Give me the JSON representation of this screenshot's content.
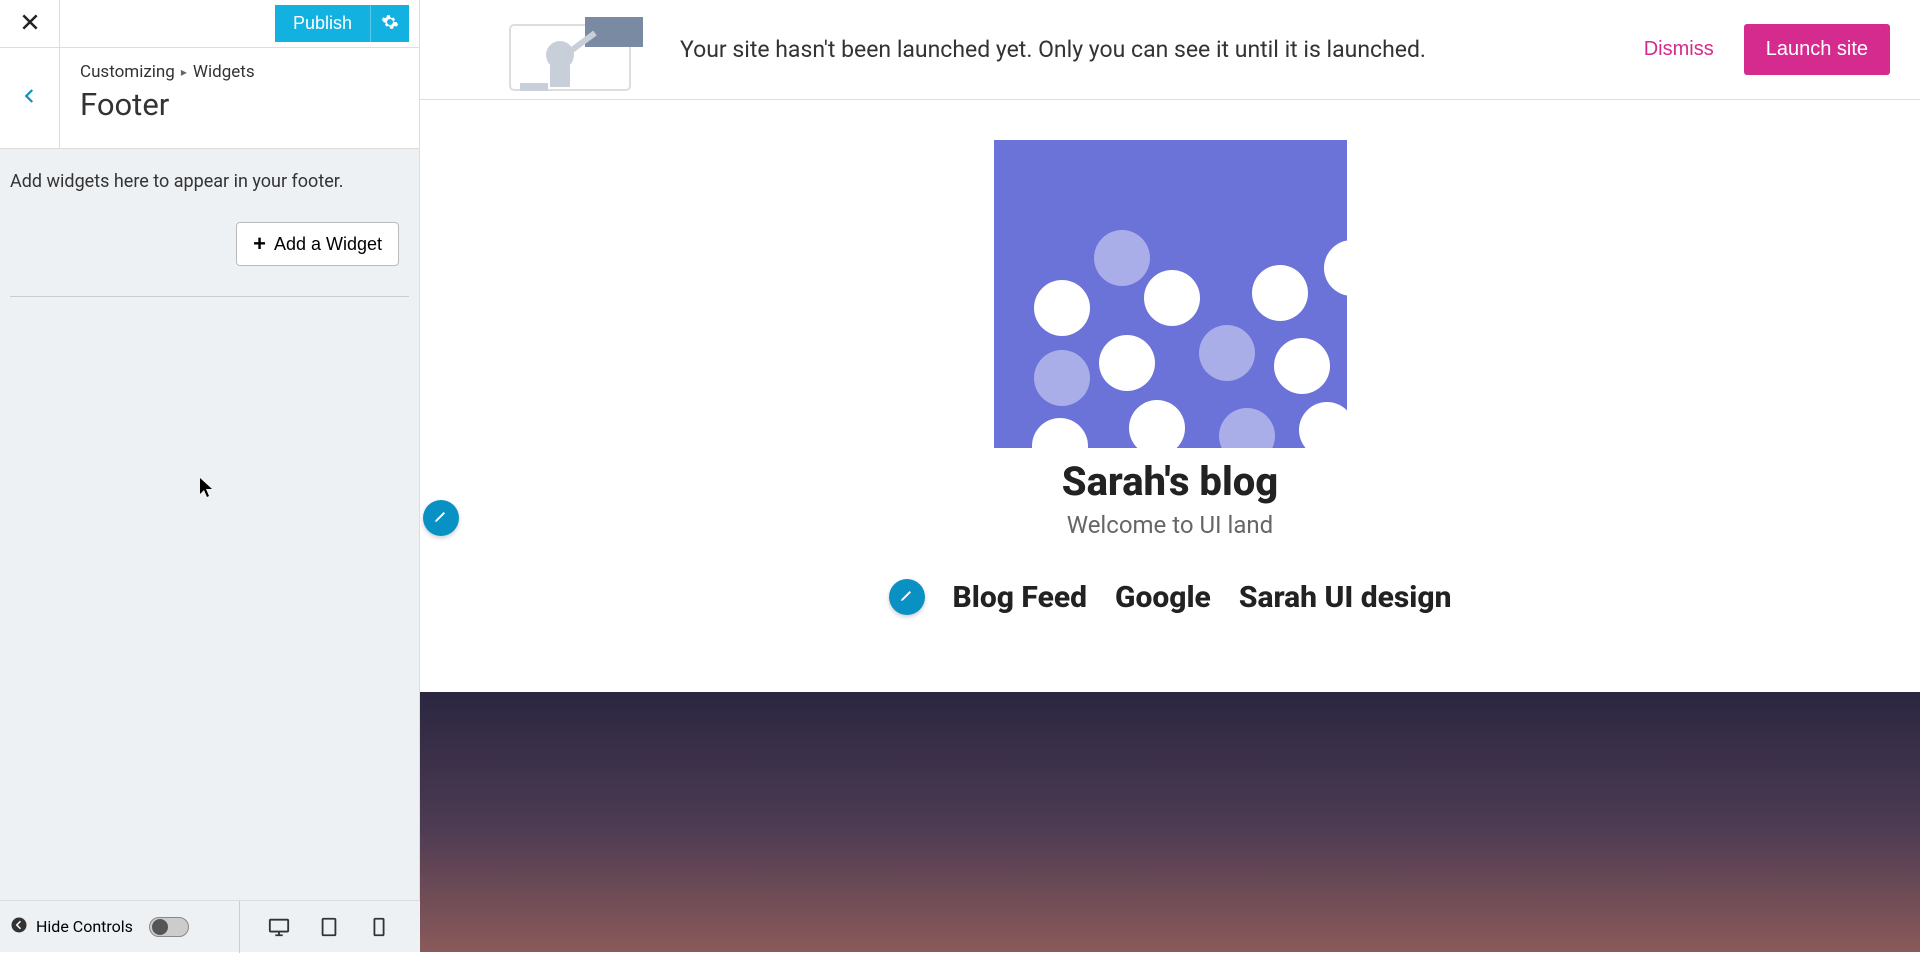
{
  "sidebar": {
    "publish_label": "Publish",
    "breadcrumb": {
      "root": "Customizing",
      "section": "Widgets"
    },
    "panel_title": "Footer",
    "description": "Add widgets here to appear in your footer.",
    "add_widget_label": "Add a Widget",
    "hide_controls_label": "Hide Controls"
  },
  "banner": {
    "message": "Your site hasn't been launched yet. Only you can see it until it is launched.",
    "dismiss_label": "Dismiss",
    "launch_label": "Launch site"
  },
  "site": {
    "title": "Sarah's blog",
    "tagline": "Welcome to UI land",
    "nav": [
      "Blog Feed",
      "Google",
      "Sarah UI design"
    ]
  },
  "colors": {
    "accent": "#12b1e0",
    "brand": "#d52a8e",
    "logo_bg": "#6b72d8"
  }
}
